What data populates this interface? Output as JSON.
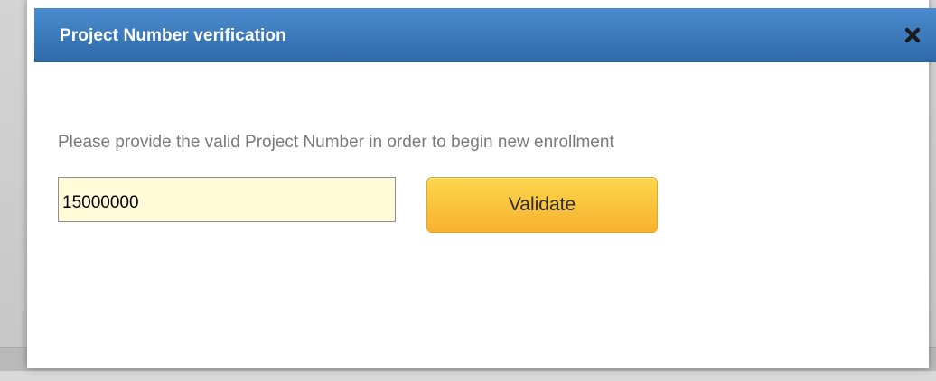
{
  "dialog": {
    "title": "Project Number verification",
    "close_icon": "close-x-icon",
    "instruction": "Please provide the valid Project Number in order to begin new enrollment",
    "project_number": {
      "value": "15000000",
      "placeholder": ""
    },
    "validate_label": "Validate"
  },
  "colors": {
    "titlebar": "#3a7abf",
    "input_background": "#fffbd8",
    "button_top": "#fdd74d",
    "button_bottom": "#f7b12f",
    "instruction_text": "#7a7a7a"
  }
}
